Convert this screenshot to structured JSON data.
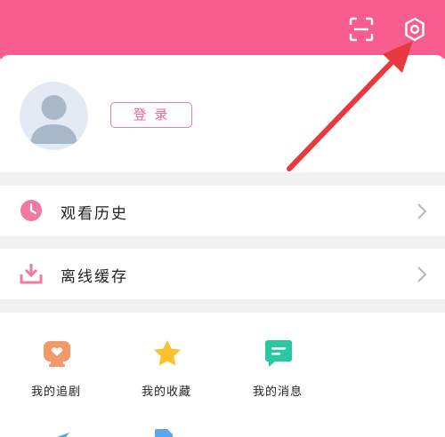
{
  "header": {
    "scan_icon": "scan-icon",
    "settings_icon": "gear-icon",
    "background_color": "#f75e8f"
  },
  "profile": {
    "avatar_icon": "default-avatar",
    "login_label": "登 录"
  },
  "menu": [
    {
      "label": "观看历史",
      "icon": "clock-icon",
      "icon_color": "#f07aa1"
    },
    {
      "label": "离线缓存",
      "icon": "download-icon",
      "icon_color": "#f07aa1"
    }
  ],
  "shortcuts": [
    {
      "label": "我的追剧",
      "icon": "tv-heart-icon",
      "icon_color": "#f39a6a"
    },
    {
      "label": "我的收藏",
      "icon": "star-icon",
      "icon_color": "#f9c22a"
    },
    {
      "label": "我的消息",
      "icon": "message-icon",
      "icon_color": "#29c7a3"
    }
  ],
  "annotation": {
    "arrow_color": "#e8393f"
  }
}
